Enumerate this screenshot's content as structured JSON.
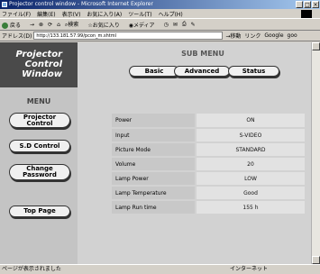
{
  "window": {
    "title": "Projector control window - Microsoft Internet Explorer",
    "controls": [
      "_",
      "□",
      "×"
    ]
  },
  "menubar": {
    "items": [
      "ファイル(F)",
      "編集(E)",
      "表示(V)",
      "お気に入り(A)",
      "ツール(T)",
      "ヘルプ(H)"
    ]
  },
  "toolbar": {
    "back": "戻る",
    "search": "検索",
    "favorites": "お気に入り",
    "media": "メディア"
  },
  "address": {
    "label": "アドレス(D)",
    "url": "http://133.181.57.99/pcon_m.shtml",
    "go": "移動",
    "links": "リンク",
    "link1": "Google",
    "link2": "goo"
  },
  "sidebar": {
    "brand": [
      "Projector",
      "Control",
      "Window"
    ],
    "menu_title": "MENU",
    "projector_control": [
      "Projector",
      "Control"
    ],
    "sd_control": "S.D Control",
    "change_password": [
      "Change",
      "Password"
    ],
    "top_page": "Top Page"
  },
  "submenu": {
    "title": "SUB MENU",
    "basic": "Basic",
    "advanced": "Advanced",
    "status": "Status"
  },
  "status_rows": [
    {
      "label": "Power",
      "value": "ON"
    },
    {
      "label": "Input",
      "value": "S-VIDEO"
    },
    {
      "label": "Picture Mode",
      "value": "STANDARD"
    },
    {
      "label": "Volume",
      "value": "20"
    },
    {
      "label": "Lamp Power",
      "value": "LOW"
    },
    {
      "label": "Lamp Temperature",
      "value": "Good"
    },
    {
      "label": "Lamp Run time",
      "value": "155 h"
    }
  ],
  "statusbar": {
    "left": "ページが表示されました",
    "right": "インターネット"
  }
}
